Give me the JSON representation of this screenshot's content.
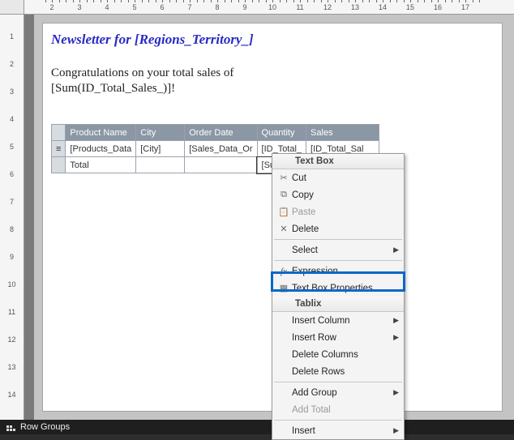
{
  "ruler": {
    "top_numbers": [
      2,
      3,
      4,
      5,
      6,
      7,
      8,
      9,
      10,
      11,
      12,
      13,
      14,
      15,
      16,
      17
    ],
    "left_numbers": [
      1,
      2,
      3,
      4,
      5,
      6,
      7,
      8,
      9,
      10,
      11,
      12,
      13,
      14
    ]
  },
  "report": {
    "title": "Newsletter for [Regions_Territory_]",
    "congrats_line1": "Congratulations on your total sales of",
    "congrats_line2": "[Sum(ID_Total_Sales_)]!"
  },
  "tablix": {
    "headers": [
      "Product Name",
      "City",
      "Order Date",
      "Quantity",
      "Sales"
    ],
    "row1": [
      "[Products_Data",
      "[City]",
      "[Sales_Data_Or",
      "[ID_Total_",
      "[ID_Total_Sal"
    ],
    "row2": [
      "Total",
      "",
      "",
      "[Sum",
      ""
    ]
  },
  "ctx": {
    "hdr1": "Text Box",
    "cut": "Cut",
    "copy": "Copy",
    "paste": "Paste",
    "delete": "Delete",
    "select": "Select",
    "expression": "Expression...",
    "textprops": "Text Box Properties...",
    "hdr2": "Tablix",
    "inscol": "Insert Column",
    "insrow": "Insert Row",
    "delcols": "Delete Columns",
    "delrows": "Delete Rows",
    "addgroup": "Add Group",
    "addtotal": "Add Total",
    "insert": "Insert"
  },
  "status": {
    "rowgroups": "Row Groups"
  }
}
